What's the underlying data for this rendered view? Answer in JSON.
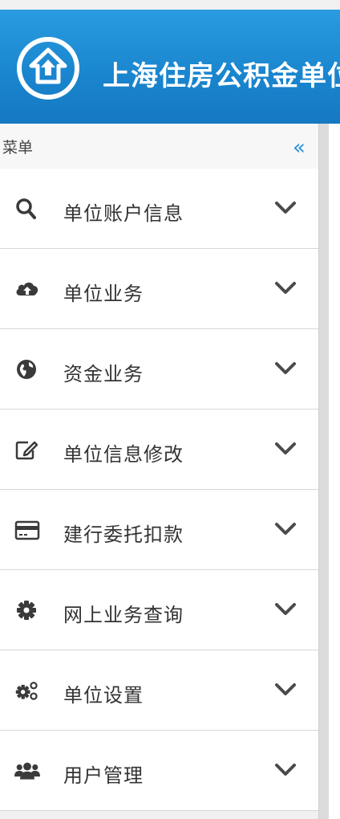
{
  "header": {
    "title": "上海住房公积金单位",
    "logo_icon": "house-up-arrow-icon",
    "bg_color": "#1a86cf"
  },
  "menu": {
    "title": "菜单",
    "collapse_label": "«",
    "accent_color": "#2a8fd8",
    "items": [
      {
        "label": "单位账户信息",
        "icon": "search-icon"
      },
      {
        "label": "单位业务",
        "icon": "cloud-upload-icon"
      },
      {
        "label": "资金业务",
        "icon": "globe-icon"
      },
      {
        "label": "单位信息修改",
        "icon": "edit-icon"
      },
      {
        "label": "建行委托扣款",
        "icon": "credit-card-icon"
      },
      {
        "label": "网上业务查询",
        "icon": "gear-icon"
      },
      {
        "label": "单位设置",
        "icon": "gears-icon"
      },
      {
        "label": "用户管理",
        "icon": "users-icon"
      }
    ]
  }
}
